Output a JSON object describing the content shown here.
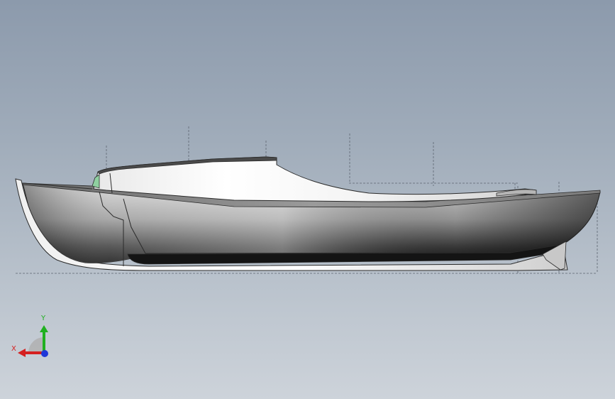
{
  "viewport": {
    "background_top": "#8c9aac",
    "background_bottom": "#cdd3da"
  },
  "model": {
    "type": "boat-hull-side-view",
    "edge_color": "#2b2b2b",
    "reference_line_color": "#5c6470"
  },
  "triad": {
    "x_label": "X",
    "y_label": "Y",
    "x_color": "#d42020",
    "y_color": "#20b020",
    "z_color": "#2038d8"
  }
}
